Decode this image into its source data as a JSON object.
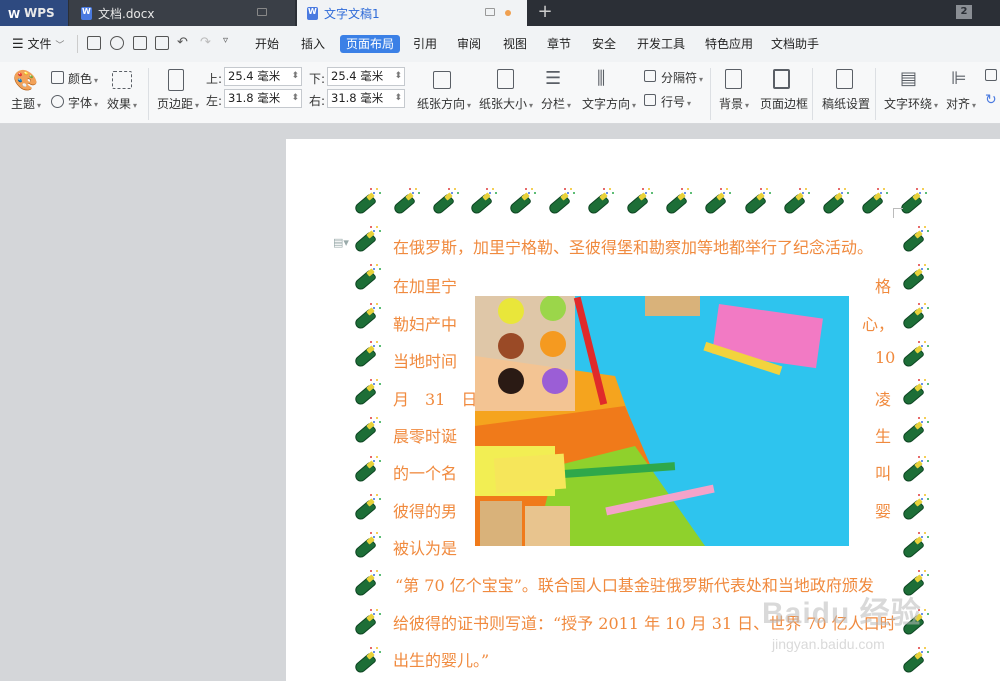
{
  "tabs": {
    "app": "WPS",
    "doc1": "文档.docx",
    "doc2": "文字文稿1",
    "window_count": "2"
  },
  "menu": {
    "file": "文件",
    "items": [
      "开始",
      "插入",
      "页面布局",
      "引用",
      "审阅",
      "视图",
      "章节",
      "安全",
      "开发工具",
      "特色应用",
      "文档助手"
    ],
    "active": "页面布局"
  },
  "ribbon": {
    "theme": "主题",
    "color": "颜色",
    "font": "字体",
    "effect": "效果",
    "margins": "页边距",
    "top_label": "上:",
    "top_value": "25.4 毫米",
    "bottom_label": "下:",
    "bottom_value": "25.4 毫米",
    "left_label": "左:",
    "left_value": "31.8 毫米",
    "right_label": "右:",
    "right_value": "31.8 毫米",
    "orientation": "纸张方向",
    "size": "纸张大小",
    "columns": "分栏",
    "text_direction": "文字方向",
    "separator": "分隔符",
    "line_number": "行号",
    "background": "背景",
    "page_border": "页面边框",
    "manuscript": "稿纸设置",
    "text_wrap": "文字环绕",
    "align": "对齐"
  },
  "document": {
    "line1": "在俄罗斯，加里宁格勒、圣彼得堡和勘察加等地都举行了纪念活动。",
    "left_lines": [
      "在加里宁",
      "勒妇产中",
      "当地时间",
      "月　31　日",
      "晨零时诞",
      "的一个名",
      "彼得的男",
      "被认为是"
    ],
    "right_lines": [
      "格",
      "心，",
      "10",
      "凌",
      "生",
      "叫",
      "婴"
    ],
    "line_after_1": "“第 70 亿个宝宝”。联合国人口基金驻俄罗斯代表处和当地政府颁发",
    "line_after_2": "给彼得的证书则写道：“授予 2011 年 10 月 31 日、世界 70 亿人口时",
    "line_after_3": "出生的婴儿。”"
  },
  "watermark": {
    "brand": "Baidu 经验",
    "url": "jingyan.baidu.com"
  },
  "colors": {
    "accent": "#3b80e6",
    "doc_text": "#f08a3e",
    "bottle": "#1d6e37"
  }
}
